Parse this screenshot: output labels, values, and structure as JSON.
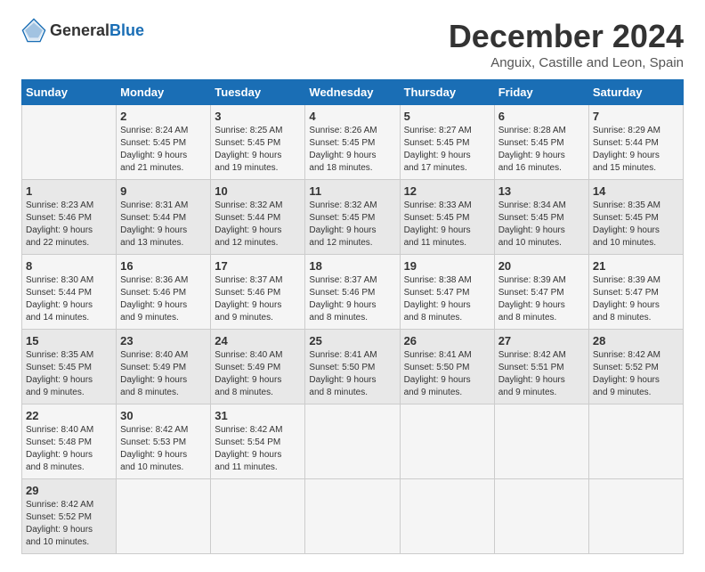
{
  "header": {
    "logo_general": "General",
    "logo_blue": "Blue",
    "month_title": "December 2024",
    "subtitle": "Anguix, Castille and Leon, Spain"
  },
  "calendar": {
    "days_of_week": [
      "Sunday",
      "Monday",
      "Tuesday",
      "Wednesday",
      "Thursday",
      "Friday",
      "Saturday"
    ],
    "weeks": [
      [
        {
          "day": "",
          "info": ""
        },
        {
          "day": "2",
          "info": "Sunrise: 8:24 AM\nSunset: 5:45 PM\nDaylight: 9 hours\nand 21 minutes."
        },
        {
          "day": "3",
          "info": "Sunrise: 8:25 AM\nSunset: 5:45 PM\nDaylight: 9 hours\nand 19 minutes."
        },
        {
          "day": "4",
          "info": "Sunrise: 8:26 AM\nSunset: 5:45 PM\nDaylight: 9 hours\nand 18 minutes."
        },
        {
          "day": "5",
          "info": "Sunrise: 8:27 AM\nSunset: 5:45 PM\nDaylight: 9 hours\nand 17 minutes."
        },
        {
          "day": "6",
          "info": "Sunrise: 8:28 AM\nSunset: 5:45 PM\nDaylight: 9 hours\nand 16 minutes."
        },
        {
          "day": "7",
          "info": "Sunrise: 8:29 AM\nSunset: 5:44 PM\nDaylight: 9 hours\nand 15 minutes."
        }
      ],
      [
        {
          "day": "1",
          "info": "Sunrise: 8:23 AM\nSunset: 5:46 PM\nDaylight: 9 hours\nand 22 minutes."
        },
        {
          "day": "9",
          "info": "Sunrise: 8:31 AM\nSunset: 5:44 PM\nDaylight: 9 hours\nand 13 minutes."
        },
        {
          "day": "10",
          "info": "Sunrise: 8:32 AM\nSunset: 5:44 PM\nDaylight: 9 hours\nand 12 minutes."
        },
        {
          "day": "11",
          "info": "Sunrise: 8:32 AM\nSunset: 5:45 PM\nDaylight: 9 hours\nand 12 minutes."
        },
        {
          "day": "12",
          "info": "Sunrise: 8:33 AM\nSunset: 5:45 PM\nDaylight: 9 hours\nand 11 minutes."
        },
        {
          "day": "13",
          "info": "Sunrise: 8:34 AM\nSunset: 5:45 PM\nDaylight: 9 hours\nand 10 minutes."
        },
        {
          "day": "14",
          "info": "Sunrise: 8:35 AM\nSunset: 5:45 PM\nDaylight: 9 hours\nand 10 minutes."
        }
      ],
      [
        {
          "day": "8",
          "info": "Sunrise: 8:30 AM\nSunset: 5:44 PM\nDaylight: 9 hours\nand 14 minutes."
        },
        {
          "day": "16",
          "info": "Sunrise: 8:36 AM\nSunset: 5:46 PM\nDaylight: 9 hours\nand 9 minutes."
        },
        {
          "day": "17",
          "info": "Sunrise: 8:37 AM\nSunset: 5:46 PM\nDaylight: 9 hours\nand 9 minutes."
        },
        {
          "day": "18",
          "info": "Sunrise: 8:37 AM\nSunset: 5:46 PM\nDaylight: 9 hours\nand 8 minutes."
        },
        {
          "day": "19",
          "info": "Sunrise: 8:38 AM\nSunset: 5:47 PM\nDaylight: 9 hours\nand 8 minutes."
        },
        {
          "day": "20",
          "info": "Sunrise: 8:39 AM\nSunset: 5:47 PM\nDaylight: 9 hours\nand 8 minutes."
        },
        {
          "day": "21",
          "info": "Sunrise: 8:39 AM\nSunset: 5:47 PM\nDaylight: 9 hours\nand 8 minutes."
        }
      ],
      [
        {
          "day": "15",
          "info": "Sunrise: 8:35 AM\nSunset: 5:45 PM\nDaylight: 9 hours\nand 9 minutes."
        },
        {
          "day": "23",
          "info": "Sunrise: 8:40 AM\nSunset: 5:49 PM\nDaylight: 9 hours\nand 8 minutes."
        },
        {
          "day": "24",
          "info": "Sunrise: 8:40 AM\nSunset: 5:49 PM\nDaylight: 9 hours\nand 8 minutes."
        },
        {
          "day": "25",
          "info": "Sunrise: 8:41 AM\nSunset: 5:50 PM\nDaylight: 9 hours\nand 8 minutes."
        },
        {
          "day": "26",
          "info": "Sunrise: 8:41 AM\nSunset: 5:50 PM\nDaylight: 9 hours\nand 9 minutes."
        },
        {
          "day": "27",
          "info": "Sunrise: 8:42 AM\nSunset: 5:51 PM\nDaylight: 9 hours\nand 9 minutes."
        },
        {
          "day": "28",
          "info": "Sunrise: 8:42 AM\nSunset: 5:52 PM\nDaylight: 9 hours\nand 9 minutes."
        }
      ],
      [
        {
          "day": "22",
          "info": "Sunrise: 8:40 AM\nSunset: 5:48 PM\nDaylight: 9 hours\nand 8 minutes."
        },
        {
          "day": "30",
          "info": "Sunrise: 8:42 AM\nSunset: 5:53 PM\nDaylight: 9 hours\nand 10 minutes."
        },
        {
          "day": "31",
          "info": "Sunrise: 8:42 AM\nSunset: 5:54 PM\nDaylight: 9 hours\nand 11 minutes."
        },
        {
          "day": "",
          "info": ""
        },
        {
          "day": "",
          "info": ""
        },
        {
          "day": "",
          "info": ""
        },
        {
          "day": "",
          "info": ""
        }
      ],
      [
        {
          "day": "29",
          "info": "Sunrise: 8:42 AM\nSunset: 5:52 PM\nDaylight: 9 hours\nand 10 minutes."
        },
        {
          "day": "",
          "info": ""
        },
        {
          "day": "",
          "info": ""
        },
        {
          "day": "",
          "info": ""
        },
        {
          "day": "",
          "info": ""
        },
        {
          "day": "",
          "info": ""
        },
        {
          "day": "",
          "info": ""
        }
      ]
    ]
  }
}
